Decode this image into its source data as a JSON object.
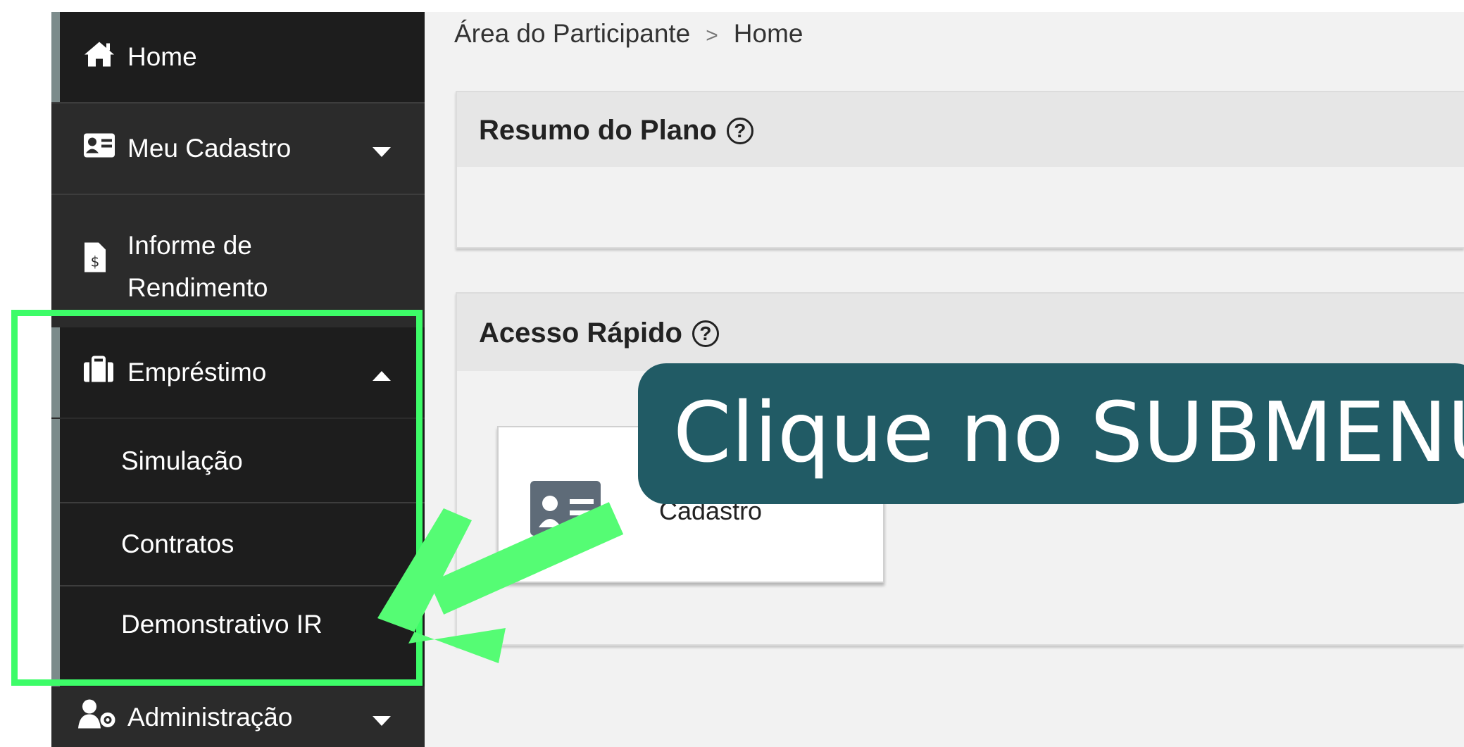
{
  "breadcrumb": {
    "parent": "Área do Participante",
    "separator": ">",
    "current": "Home"
  },
  "sidebar": {
    "items": [
      {
        "label": "Home",
        "icon": "home-icon"
      },
      {
        "label": "Meu Cadastro",
        "icon": "id-card-icon"
      },
      {
        "label_line1": "Informe de",
        "label_line2": "Rendimento",
        "icon": "document-dollar-icon"
      },
      {
        "label": "Empréstimo",
        "icon": "briefcase-icon",
        "submenu": [
          "Simulação",
          "Contratos",
          "Demonstrativo IR"
        ]
      },
      {
        "label": "Administração",
        "icon": "user-gear-icon"
      }
    ]
  },
  "panels": {
    "resumo_title": "Resumo do Plano",
    "acesso_title": "Acesso Rápido",
    "help_glyph": "?",
    "card_label": "Cadastro"
  },
  "annotation": {
    "callout_text": "Clique no SUBMENU",
    "callout_color": "#215b65",
    "highlight_color": "#3dfc68"
  }
}
